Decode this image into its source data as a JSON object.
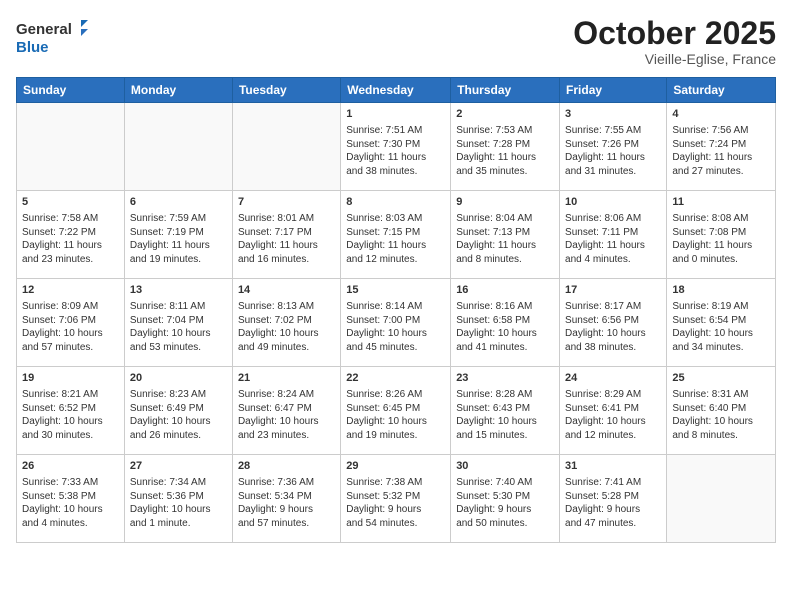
{
  "logo": {
    "line1": "General",
    "line2": "Blue"
  },
  "title": "October 2025",
  "location": "Vieille-Eglise, France",
  "weekdays": [
    "Sunday",
    "Monday",
    "Tuesday",
    "Wednesday",
    "Thursday",
    "Friday",
    "Saturday"
  ],
  "weeks": [
    [
      {
        "day": "",
        "info": ""
      },
      {
        "day": "",
        "info": ""
      },
      {
        "day": "",
        "info": ""
      },
      {
        "day": "1",
        "info": "Sunrise: 7:51 AM\nSunset: 7:30 PM\nDaylight: 11 hours\nand 38 minutes."
      },
      {
        "day": "2",
        "info": "Sunrise: 7:53 AM\nSunset: 7:28 PM\nDaylight: 11 hours\nand 35 minutes."
      },
      {
        "day": "3",
        "info": "Sunrise: 7:55 AM\nSunset: 7:26 PM\nDaylight: 11 hours\nand 31 minutes."
      },
      {
        "day": "4",
        "info": "Sunrise: 7:56 AM\nSunset: 7:24 PM\nDaylight: 11 hours\nand 27 minutes."
      }
    ],
    [
      {
        "day": "5",
        "info": "Sunrise: 7:58 AM\nSunset: 7:22 PM\nDaylight: 11 hours\nand 23 minutes."
      },
      {
        "day": "6",
        "info": "Sunrise: 7:59 AM\nSunset: 7:19 PM\nDaylight: 11 hours\nand 19 minutes."
      },
      {
        "day": "7",
        "info": "Sunrise: 8:01 AM\nSunset: 7:17 PM\nDaylight: 11 hours\nand 16 minutes."
      },
      {
        "day": "8",
        "info": "Sunrise: 8:03 AM\nSunset: 7:15 PM\nDaylight: 11 hours\nand 12 minutes."
      },
      {
        "day": "9",
        "info": "Sunrise: 8:04 AM\nSunset: 7:13 PM\nDaylight: 11 hours\nand 8 minutes."
      },
      {
        "day": "10",
        "info": "Sunrise: 8:06 AM\nSunset: 7:11 PM\nDaylight: 11 hours\nand 4 minutes."
      },
      {
        "day": "11",
        "info": "Sunrise: 8:08 AM\nSunset: 7:08 PM\nDaylight: 11 hours\nand 0 minutes."
      }
    ],
    [
      {
        "day": "12",
        "info": "Sunrise: 8:09 AM\nSunset: 7:06 PM\nDaylight: 10 hours\nand 57 minutes."
      },
      {
        "day": "13",
        "info": "Sunrise: 8:11 AM\nSunset: 7:04 PM\nDaylight: 10 hours\nand 53 minutes."
      },
      {
        "day": "14",
        "info": "Sunrise: 8:13 AM\nSunset: 7:02 PM\nDaylight: 10 hours\nand 49 minutes."
      },
      {
        "day": "15",
        "info": "Sunrise: 8:14 AM\nSunset: 7:00 PM\nDaylight: 10 hours\nand 45 minutes."
      },
      {
        "day": "16",
        "info": "Sunrise: 8:16 AM\nSunset: 6:58 PM\nDaylight: 10 hours\nand 41 minutes."
      },
      {
        "day": "17",
        "info": "Sunrise: 8:17 AM\nSunset: 6:56 PM\nDaylight: 10 hours\nand 38 minutes."
      },
      {
        "day": "18",
        "info": "Sunrise: 8:19 AM\nSunset: 6:54 PM\nDaylight: 10 hours\nand 34 minutes."
      }
    ],
    [
      {
        "day": "19",
        "info": "Sunrise: 8:21 AM\nSunset: 6:52 PM\nDaylight: 10 hours\nand 30 minutes."
      },
      {
        "day": "20",
        "info": "Sunrise: 8:23 AM\nSunset: 6:49 PM\nDaylight: 10 hours\nand 26 minutes."
      },
      {
        "day": "21",
        "info": "Sunrise: 8:24 AM\nSunset: 6:47 PM\nDaylight: 10 hours\nand 23 minutes."
      },
      {
        "day": "22",
        "info": "Sunrise: 8:26 AM\nSunset: 6:45 PM\nDaylight: 10 hours\nand 19 minutes."
      },
      {
        "day": "23",
        "info": "Sunrise: 8:28 AM\nSunset: 6:43 PM\nDaylight: 10 hours\nand 15 minutes."
      },
      {
        "day": "24",
        "info": "Sunrise: 8:29 AM\nSunset: 6:41 PM\nDaylight: 10 hours\nand 12 minutes."
      },
      {
        "day": "25",
        "info": "Sunrise: 8:31 AM\nSunset: 6:40 PM\nDaylight: 10 hours\nand 8 minutes."
      }
    ],
    [
      {
        "day": "26",
        "info": "Sunrise: 7:33 AM\nSunset: 5:38 PM\nDaylight: 10 hours\nand 4 minutes."
      },
      {
        "day": "27",
        "info": "Sunrise: 7:34 AM\nSunset: 5:36 PM\nDaylight: 10 hours\nand 1 minute."
      },
      {
        "day": "28",
        "info": "Sunrise: 7:36 AM\nSunset: 5:34 PM\nDaylight: 9 hours\nand 57 minutes."
      },
      {
        "day": "29",
        "info": "Sunrise: 7:38 AM\nSunset: 5:32 PM\nDaylight: 9 hours\nand 54 minutes."
      },
      {
        "day": "30",
        "info": "Sunrise: 7:40 AM\nSunset: 5:30 PM\nDaylight: 9 hours\nand 50 minutes."
      },
      {
        "day": "31",
        "info": "Sunrise: 7:41 AM\nSunset: 5:28 PM\nDaylight: 9 hours\nand 47 minutes."
      },
      {
        "day": "",
        "info": ""
      }
    ]
  ]
}
